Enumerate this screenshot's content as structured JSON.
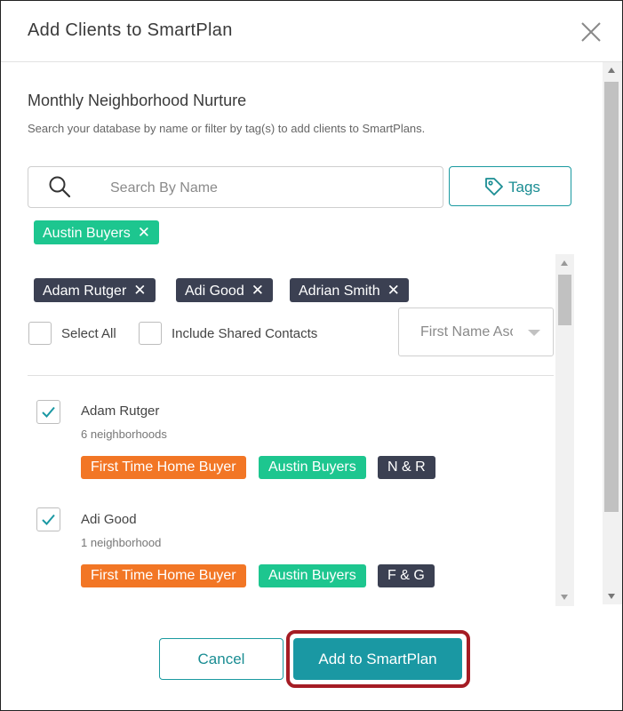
{
  "dialog": {
    "title": "Add Clients to SmartPlan",
    "close_icon": "close-icon"
  },
  "plan": {
    "name": "Monthly Neighborhood Nurture",
    "description": "Search your database by name or filter by tag(s) to add clients to SmartPlans."
  },
  "search": {
    "placeholder": "Search By Name",
    "value": "",
    "icon": "search-icon"
  },
  "tags_button": {
    "label": "Tags",
    "icon": "tag-icon"
  },
  "tag_filters": [
    {
      "label": "Austin Buyers",
      "remove": "✕"
    }
  ],
  "selected_clients": [
    {
      "label": "Adam Rutger",
      "remove": "✕"
    },
    {
      "label": "Adi Good",
      "remove": "✕"
    },
    {
      "label": "Adrian Smith",
      "remove": "✕"
    }
  ],
  "options": {
    "select_all": {
      "label": "Select All",
      "checked": false
    },
    "include_shared": {
      "label": "Include Shared Contacts",
      "checked": false
    }
  },
  "sort": {
    "value": "First Name Ascending"
  },
  "contacts": [
    {
      "name": "Adam Rutger",
      "subtitle": "6 neighborhoods",
      "checked": true,
      "tags": [
        "First Time Home Buyer",
        "Austin Buyers",
        "N & R"
      ]
    },
    {
      "name": "Adi Good",
      "subtitle": "1 neighborhood",
      "checked": true,
      "tags": [
        "First Time Home Buyer",
        "Austin Buyers",
        "F & G"
      ]
    }
  ],
  "footer": {
    "cancel_label": "Cancel",
    "add_label": "Add to SmartPlan"
  },
  "colors": {
    "accent": "#1a98a3",
    "tag_green": "#1dc68f",
    "tag_orange": "#f27625",
    "tag_dark": "#3b4052",
    "highlight": "#a51c24"
  }
}
